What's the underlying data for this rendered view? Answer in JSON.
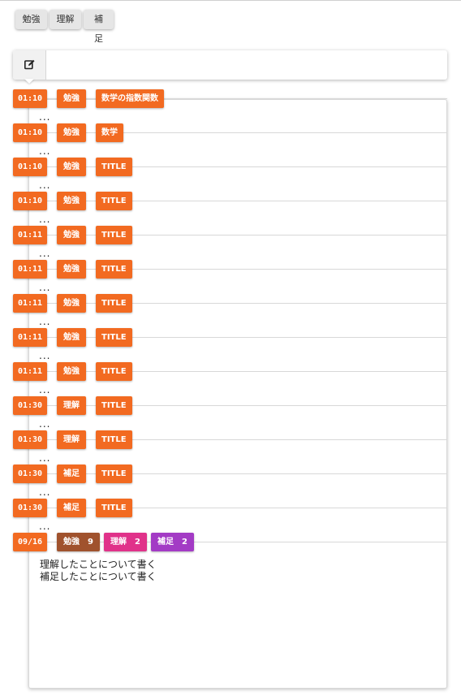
{
  "filters": [
    {
      "label": "勉強"
    },
    {
      "label": "理解"
    },
    {
      "label": "補足"
    }
  ],
  "entry_bar": {
    "edit_icon": "edit-icon",
    "value": "",
    "placeholder": ""
  },
  "colors": {
    "tag": "#f26a21",
    "study": "#a0522d",
    "understand": "#e0328a",
    "supplement": "#a33bc5"
  },
  "log": [
    {
      "time": "01:10",
      "category": "勉強",
      "title": "数学の指数関数"
    },
    {
      "time": "01:10",
      "category": "勉強",
      "title": "数学"
    },
    {
      "time": "01:10",
      "category": "勉強",
      "title": "TITLE"
    },
    {
      "time": "01:10",
      "category": "勉強",
      "title": "TITLE"
    },
    {
      "time": "01:11",
      "category": "勉強",
      "title": "TITLE"
    },
    {
      "time": "01:11",
      "category": "勉強",
      "title": "TITLE"
    },
    {
      "time": "01:11",
      "category": "勉強",
      "title": "TITLE"
    },
    {
      "time": "01:11",
      "category": "勉強",
      "title": "TITLE"
    },
    {
      "time": "01:11",
      "category": "勉強",
      "title": "TITLE"
    },
    {
      "time": "01:30",
      "category": "理解",
      "title": "TITLE"
    },
    {
      "time": "01:30",
      "category": "理解",
      "title": "TITLE"
    },
    {
      "time": "01:30",
      "category": "補足",
      "title": "TITLE"
    },
    {
      "time": "01:30",
      "category": "補足",
      "title": "TITLE"
    }
  ],
  "ellipsis": "...",
  "summary": {
    "date": "09/16",
    "items": [
      {
        "label": "勉強",
        "count": "9"
      },
      {
        "label": "理解",
        "count": "2"
      },
      {
        "label": "補足",
        "count": "2"
      }
    ]
  },
  "notes": [
    "理解したことについて書く",
    "補足したことについて書く"
  ]
}
